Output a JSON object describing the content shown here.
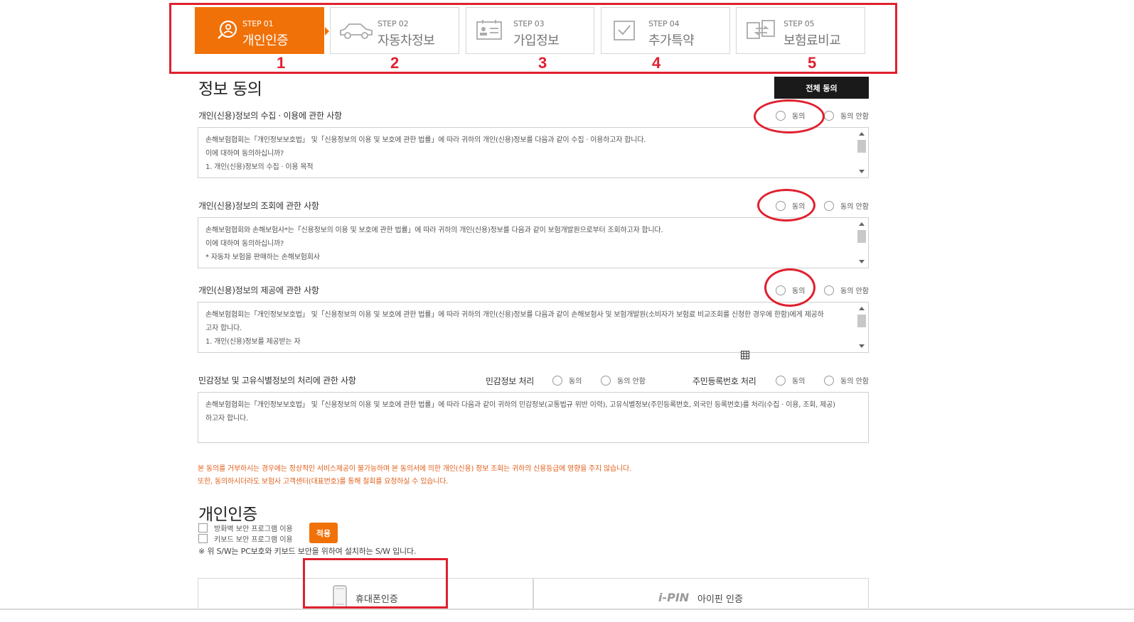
{
  "steps": [
    {
      "no": "STEP 01",
      "name": "개인인증",
      "icon": "search-person-icon",
      "active": true
    },
    {
      "no": "STEP 02",
      "name": "자동차정보",
      "icon": "car-icon"
    },
    {
      "no": "STEP 03",
      "name": "가입정보",
      "icon": "id-card-icon"
    },
    {
      "no": "STEP 04",
      "name": "추가특약",
      "icon": "checkbox-icon"
    },
    {
      "no": "STEP 05",
      "name": "보험료비교",
      "icon": "compare-arrows-icon"
    }
  ],
  "annotations": {
    "numbers": [
      "1",
      "2",
      "3",
      "4",
      "5"
    ],
    "color": "#e0202f"
  },
  "consent": {
    "title": "정보 동의",
    "all_agree": "전체 동의",
    "sections": [
      {
        "title": "개인(신용)정보의 수집 · 이용에 관한 사항",
        "agree": "동의",
        "disagree": "동의 안함",
        "lines": [
          "손해보험협회는「개인정보보호법」 및「신용정보의 이용 및 보호에 관한 법률」에 따라 귀하의 개인(신용)정보를 다음과 같이 수집 · 이용하고자 합니다.",
          "이에 대하여 동의하십니까?",
          "1. 개인(신용)정보의 수집 · 이용 목적"
        ]
      },
      {
        "title": "개인(신용)정보의 조회에 관한 사항",
        "agree": "동의",
        "disagree": "동의 안함",
        "lines": [
          "손해보험협회와 손해보험사*는「신용정보의 이용 및 보호에 관한 법률」에 따라 귀하의 개인(신용)정보를 다음과 같이 보험개발원으로부터 조회하고자 합니다.",
          "이에 대하여 동의하십니까?",
          "* 자동차 보험을 판매하는 손해보험회사"
        ]
      },
      {
        "title": "개인(신용)정보의 제공에 관한 사항",
        "agree": "동의",
        "disagree": "동의 안함",
        "lines": [
          "손해보험협회는「개인정보보호법」 및「신용정보의 이용 및 보호에 관한 법률」에 따라 귀하의 개인(신용)정보를 다음과 같이 손해보험사 및 보험개발원(소비자가 보험료 비교조회를 신청한 경우에 한함)에게 제공하",
          "고자 합니다.",
          "1. 개인(신용)정보를 제공받는 자"
        ]
      }
    ],
    "sensitive": {
      "title": "민감정보 및 고유식별정보의 처리에 관한 사항",
      "sensitive_label": "민감정보 처리",
      "resident_label": "주민등록번호 처리",
      "agree": "동의",
      "disagree": "동의 안함",
      "lines": [
        "손해보험협회는「개인정보보호법」 및「신용정보의 이용 및 보호에 관한 법률」에 따라 다음과 같이 귀하의 민감정보(교통법규 위반 이력), 고유식별정보(주민등록번호, 외국인 등록번호)를 처리(수집 · 이용, 조회, 제공)",
        "하고자 합니다."
      ]
    },
    "warnings": [
      "본 동의를 거부하시는 경우에는 정상적인 서비스제공이 불가능하며 본 동의서에 의한 개인(신용) 정보 조회는 귀하의 신용등급에 영향을 주지 않습니다.",
      "또한, 동의하시더라도 보험사 고객센터(대표번호)를 통해 철회를 요청하실 수 있습니다."
    ]
  },
  "auth": {
    "title": "개인인증",
    "checkboxes": [
      "방화벽 보안 프로그램 이용",
      "키보드 보안 프로그램 이용"
    ],
    "apply": "적용",
    "note": "※ 위 S/W는 PC보호와 키보드 보안을 위하여 설치하는 S/W 입니다.",
    "phone_label": "휴대폰인증",
    "ipin_logo": "i-PIN",
    "ipin_label": "아이핀 인증"
  },
  "colors": {
    "accent": "#f07108",
    "warning": "#e2601c",
    "annotation": "#e0202f"
  }
}
